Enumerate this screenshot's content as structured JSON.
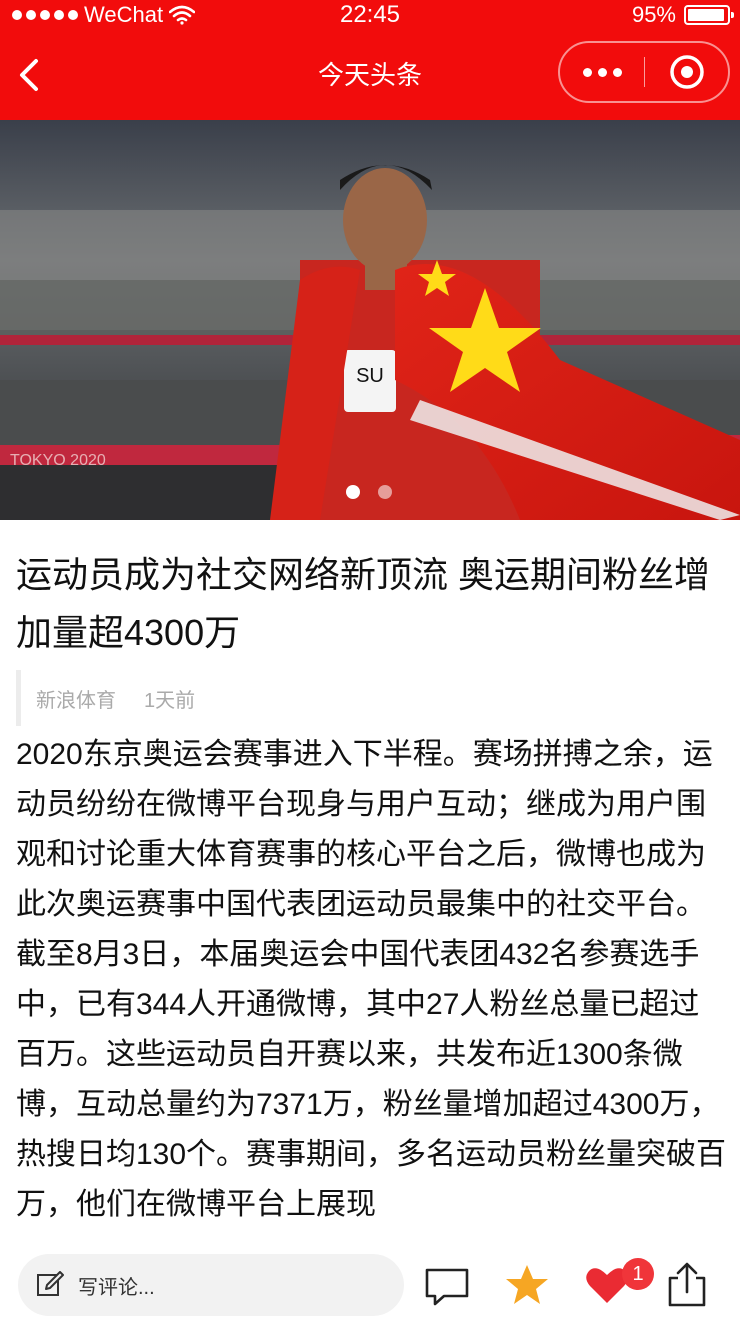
{
  "status_bar": {
    "carrier": "WeChat",
    "time": "22:45",
    "battery": "95%"
  },
  "nav": {
    "title": "今天头条"
  },
  "hero": {
    "caption": "SU",
    "slide_count": 2,
    "active_slide": 1
  },
  "article": {
    "headline": "运动员成为社交网络新顶流 奥运期间粉丝增加量超4300万",
    "source": "新浪体育",
    "time": "1天前",
    "body": "2020东京奥运会赛事进入下半程。赛场拼搏之余，运动员纷纷在微博平台现身与用户互动；继成为用户围观和讨论重大体育赛事的核心平台之后，微博也成为此次奥运赛事中国代表团运动员最集中的社交平台。截至8月3日，本届奥运会中国代表团432名参赛选手中，已有344人开通微博，其中27人粉丝总量已超过百万。这些运动员自开赛以来，共发布近1300条微博，互动总量约为7371万，粉丝量增加超过4300万，热搜日均130个。赛事期间，多名运动员粉丝量突破百万，他们在微博平台上展现"
  },
  "toolbar": {
    "comment_placeholder": "写评论...",
    "like_count": "1"
  },
  "colors": {
    "brand_red": "#f20c0c",
    "star": "#f6a623",
    "heart": "#ea2b33",
    "badge": "#f0353a"
  },
  "icons": [
    "back-arrow-icon",
    "more-dots-icon",
    "close-target-icon",
    "edit-icon",
    "comment-icon",
    "star-icon",
    "heart-icon",
    "share-icon"
  ]
}
